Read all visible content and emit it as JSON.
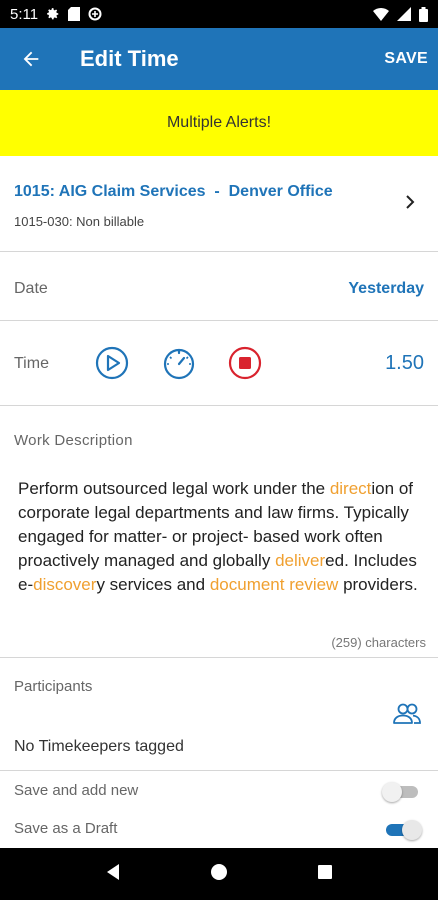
{
  "status_bar": {
    "time": "5:11",
    "left_icons": [
      "settings-icon",
      "sd-card-icon",
      "sync-icon"
    ],
    "right_icons": [
      "wifi-icon",
      "cellular-icon",
      "battery-icon"
    ]
  },
  "app_bar": {
    "title": "Edit Time",
    "save_label": "SAVE",
    "back_icon": "arrow-back-icon"
  },
  "alert": {
    "text": "Multiple Alerts!",
    "background": "#ffff00"
  },
  "project": {
    "name": "1015: AIG Claim Services  -  Denver Office",
    "task": "1015-030: Non billable"
  },
  "date": {
    "label": "Date",
    "value": "Yesterday"
  },
  "time": {
    "label": "Time",
    "value": "1.50",
    "controls": [
      "play-icon",
      "timer-icon",
      "stop-icon"
    ]
  },
  "work_description": {
    "label": "Work Description",
    "segments": [
      {
        "text": "Perform outsourced legal work under the ",
        "highlight": false
      },
      {
        "text": "direct",
        "highlight": true
      },
      {
        "text": "ion of corporate legal departments and law firms. Typically engaged for matter- or project- based work often proactively managed and globally ",
        "highlight": false
      },
      {
        "text": "deliver",
        "highlight": true
      },
      {
        "text": "ed. Includes e-",
        "highlight": false
      },
      {
        "text": "discover",
        "highlight": true
      },
      {
        "text": "y services and ",
        "highlight": false
      },
      {
        "text": "document review",
        "highlight": true
      },
      {
        "text": " providers.",
        "highlight": false
      }
    ],
    "char_count": "(259) characters"
  },
  "participants": {
    "label": "Participants",
    "empty_text": "No Timekeepers tagged"
  },
  "toggles": [
    {
      "label": "Save and add new",
      "on": false
    },
    {
      "label": "Save as a Draft",
      "on": true
    }
  ],
  "colors": {
    "primary": "#1f74b8",
    "highlight": "#f0a030",
    "stop": "#d9232e"
  }
}
